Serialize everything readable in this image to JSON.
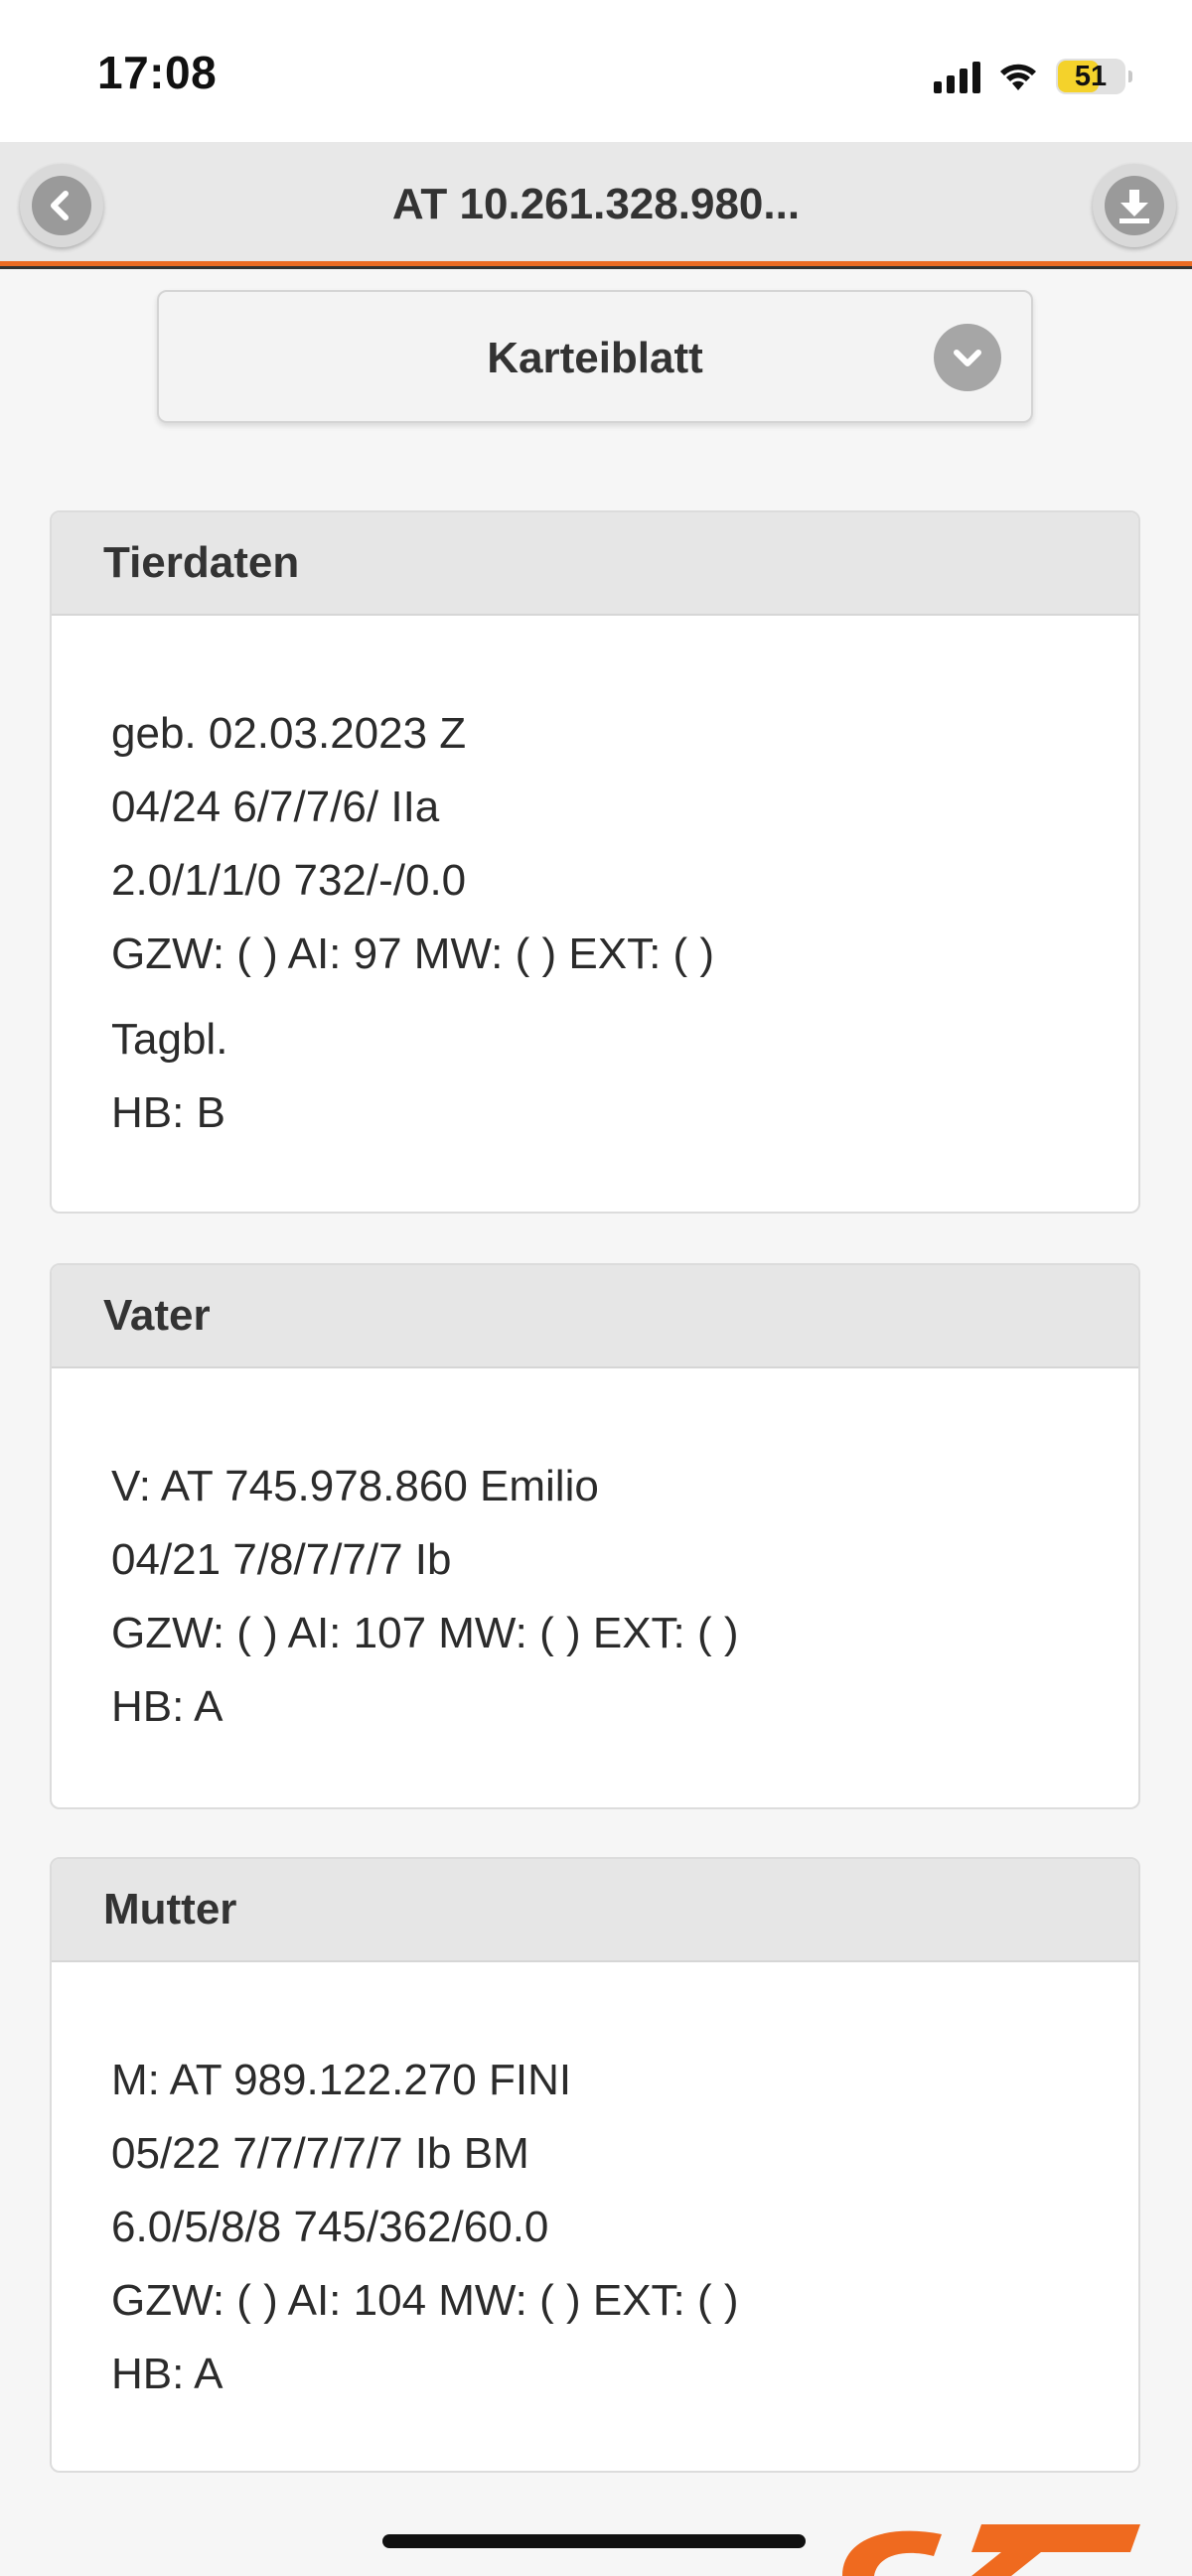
{
  "status_bar": {
    "time": "17:08",
    "battery_level": "51",
    "battery_color": "#f4d22b"
  },
  "header": {
    "title": "AT 10.261.328.980...",
    "back_icon": "chevron-left-icon",
    "download_icon": "download-icon",
    "accent_color": "#ec6c24"
  },
  "dropdown": {
    "selected": "Karteiblatt",
    "icon": "chevron-down-icon"
  },
  "sections": {
    "tierdaten": {
      "title": "Tierdaten",
      "lines": [
        "geb. 02.03.2023 Z",
        "04/24 6/7/7/6/ IIa",
        "2.0/1/1/0 732/-/0.0",
        "GZW: ( ) AI: 97 MW: ( ) EXT: ( )",
        "Tagbl.",
        "HB: B"
      ]
    },
    "vater": {
      "title": "Vater",
      "lines": [
        "V: AT 745.978.860 Emilio",
        "04/21 7/8/7/7/7 Ib",
        "GZW: ( ) AI: 107 MW: ( ) EXT: ( )",
        "HB: A"
      ]
    },
    "mutter": {
      "title": "Mutter",
      "lines": [
        "M: AT 989.122.270 FINI",
        "05/22 7/7/7/7/7 Ib BM",
        "6.0/5/8/8 745/362/60.0",
        "GZW: ( ) AI: 104 MW: ( ) EXT: ( )",
        "HB: A"
      ]
    }
  }
}
